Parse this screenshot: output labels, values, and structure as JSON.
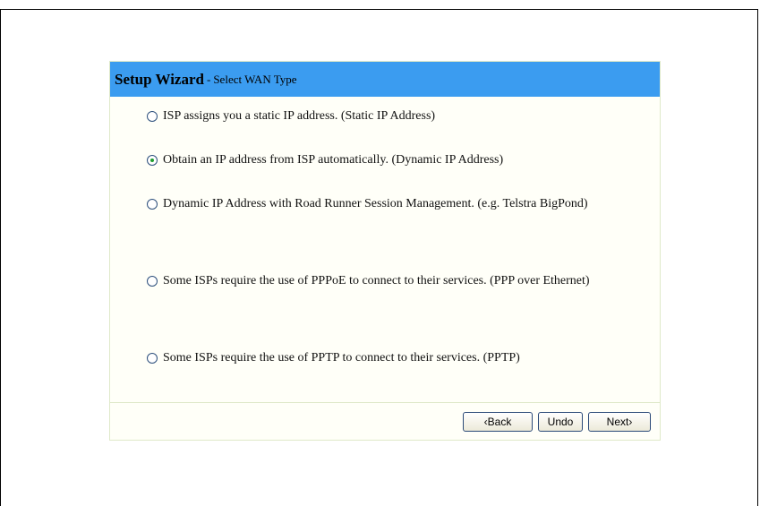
{
  "wizard": {
    "title": "Setup Wizard",
    "separator": "-",
    "subtitle": "Select WAN Type",
    "selected_index": 1,
    "options": [
      {
        "label": "ISP assigns you a static IP address. (Static IP Address)"
      },
      {
        "label": "Obtain an IP address from ISP automatically. (Dynamic IP Address)"
      },
      {
        "label": "Dynamic IP Address with Road Runner Session Management. (e.g. Telstra BigPond)"
      },
      {
        "label": "Some ISPs require the use of PPPoE to connect to their services. (PPP over Ethernet)"
      },
      {
        "label": "Some ISPs require the use of PPTP to connect to their services. (PPTP)"
      }
    ]
  },
  "buttons": {
    "back": "‹Back",
    "undo": "Undo",
    "next": "Next›"
  },
  "colors": {
    "header_bg": "#3b9cf0",
    "panel_border": "#dfe9c9",
    "radio_selected": "#1f9d2f"
  }
}
